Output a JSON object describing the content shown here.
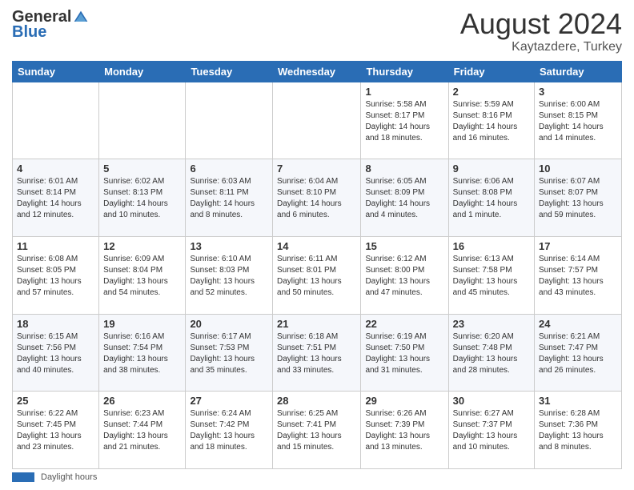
{
  "logo": {
    "general": "General",
    "blue": "Blue"
  },
  "header": {
    "month_year": "August 2024",
    "location": "Kaytazdere, Turkey"
  },
  "days_of_week": [
    "Sunday",
    "Monday",
    "Tuesday",
    "Wednesday",
    "Thursday",
    "Friday",
    "Saturday"
  ],
  "weeks": [
    [
      {
        "num": "",
        "detail": ""
      },
      {
        "num": "",
        "detail": ""
      },
      {
        "num": "",
        "detail": ""
      },
      {
        "num": "",
        "detail": ""
      },
      {
        "num": "1",
        "detail": "Sunrise: 5:58 AM\nSunset: 8:17 PM\nDaylight: 14 hours\nand 18 minutes."
      },
      {
        "num": "2",
        "detail": "Sunrise: 5:59 AM\nSunset: 8:16 PM\nDaylight: 14 hours\nand 16 minutes."
      },
      {
        "num": "3",
        "detail": "Sunrise: 6:00 AM\nSunset: 8:15 PM\nDaylight: 14 hours\nand 14 minutes."
      }
    ],
    [
      {
        "num": "4",
        "detail": "Sunrise: 6:01 AM\nSunset: 8:14 PM\nDaylight: 14 hours\nand 12 minutes."
      },
      {
        "num": "5",
        "detail": "Sunrise: 6:02 AM\nSunset: 8:13 PM\nDaylight: 14 hours\nand 10 minutes."
      },
      {
        "num": "6",
        "detail": "Sunrise: 6:03 AM\nSunset: 8:11 PM\nDaylight: 14 hours\nand 8 minutes."
      },
      {
        "num": "7",
        "detail": "Sunrise: 6:04 AM\nSunset: 8:10 PM\nDaylight: 14 hours\nand 6 minutes."
      },
      {
        "num": "8",
        "detail": "Sunrise: 6:05 AM\nSunset: 8:09 PM\nDaylight: 14 hours\nand 4 minutes."
      },
      {
        "num": "9",
        "detail": "Sunrise: 6:06 AM\nSunset: 8:08 PM\nDaylight: 14 hours\nand 1 minute."
      },
      {
        "num": "10",
        "detail": "Sunrise: 6:07 AM\nSunset: 8:07 PM\nDaylight: 13 hours\nand 59 minutes."
      }
    ],
    [
      {
        "num": "11",
        "detail": "Sunrise: 6:08 AM\nSunset: 8:05 PM\nDaylight: 13 hours\nand 57 minutes."
      },
      {
        "num": "12",
        "detail": "Sunrise: 6:09 AM\nSunset: 8:04 PM\nDaylight: 13 hours\nand 54 minutes."
      },
      {
        "num": "13",
        "detail": "Sunrise: 6:10 AM\nSunset: 8:03 PM\nDaylight: 13 hours\nand 52 minutes."
      },
      {
        "num": "14",
        "detail": "Sunrise: 6:11 AM\nSunset: 8:01 PM\nDaylight: 13 hours\nand 50 minutes."
      },
      {
        "num": "15",
        "detail": "Sunrise: 6:12 AM\nSunset: 8:00 PM\nDaylight: 13 hours\nand 47 minutes."
      },
      {
        "num": "16",
        "detail": "Sunrise: 6:13 AM\nSunset: 7:58 PM\nDaylight: 13 hours\nand 45 minutes."
      },
      {
        "num": "17",
        "detail": "Sunrise: 6:14 AM\nSunset: 7:57 PM\nDaylight: 13 hours\nand 43 minutes."
      }
    ],
    [
      {
        "num": "18",
        "detail": "Sunrise: 6:15 AM\nSunset: 7:56 PM\nDaylight: 13 hours\nand 40 minutes."
      },
      {
        "num": "19",
        "detail": "Sunrise: 6:16 AM\nSunset: 7:54 PM\nDaylight: 13 hours\nand 38 minutes."
      },
      {
        "num": "20",
        "detail": "Sunrise: 6:17 AM\nSunset: 7:53 PM\nDaylight: 13 hours\nand 35 minutes."
      },
      {
        "num": "21",
        "detail": "Sunrise: 6:18 AM\nSunset: 7:51 PM\nDaylight: 13 hours\nand 33 minutes."
      },
      {
        "num": "22",
        "detail": "Sunrise: 6:19 AM\nSunset: 7:50 PM\nDaylight: 13 hours\nand 31 minutes."
      },
      {
        "num": "23",
        "detail": "Sunrise: 6:20 AM\nSunset: 7:48 PM\nDaylight: 13 hours\nand 28 minutes."
      },
      {
        "num": "24",
        "detail": "Sunrise: 6:21 AM\nSunset: 7:47 PM\nDaylight: 13 hours\nand 26 minutes."
      }
    ],
    [
      {
        "num": "25",
        "detail": "Sunrise: 6:22 AM\nSunset: 7:45 PM\nDaylight: 13 hours\nand 23 minutes."
      },
      {
        "num": "26",
        "detail": "Sunrise: 6:23 AM\nSunset: 7:44 PM\nDaylight: 13 hours\nand 21 minutes."
      },
      {
        "num": "27",
        "detail": "Sunrise: 6:24 AM\nSunset: 7:42 PM\nDaylight: 13 hours\nand 18 minutes."
      },
      {
        "num": "28",
        "detail": "Sunrise: 6:25 AM\nSunset: 7:41 PM\nDaylight: 13 hours\nand 15 minutes."
      },
      {
        "num": "29",
        "detail": "Sunrise: 6:26 AM\nSunset: 7:39 PM\nDaylight: 13 hours\nand 13 minutes."
      },
      {
        "num": "30",
        "detail": "Sunrise: 6:27 AM\nSunset: 7:37 PM\nDaylight: 13 hours\nand 10 minutes."
      },
      {
        "num": "31",
        "detail": "Sunrise: 6:28 AM\nSunset: 7:36 PM\nDaylight: 13 hours\nand 8 minutes."
      }
    ]
  ],
  "footer": {
    "legend_label": "Daylight hours"
  }
}
